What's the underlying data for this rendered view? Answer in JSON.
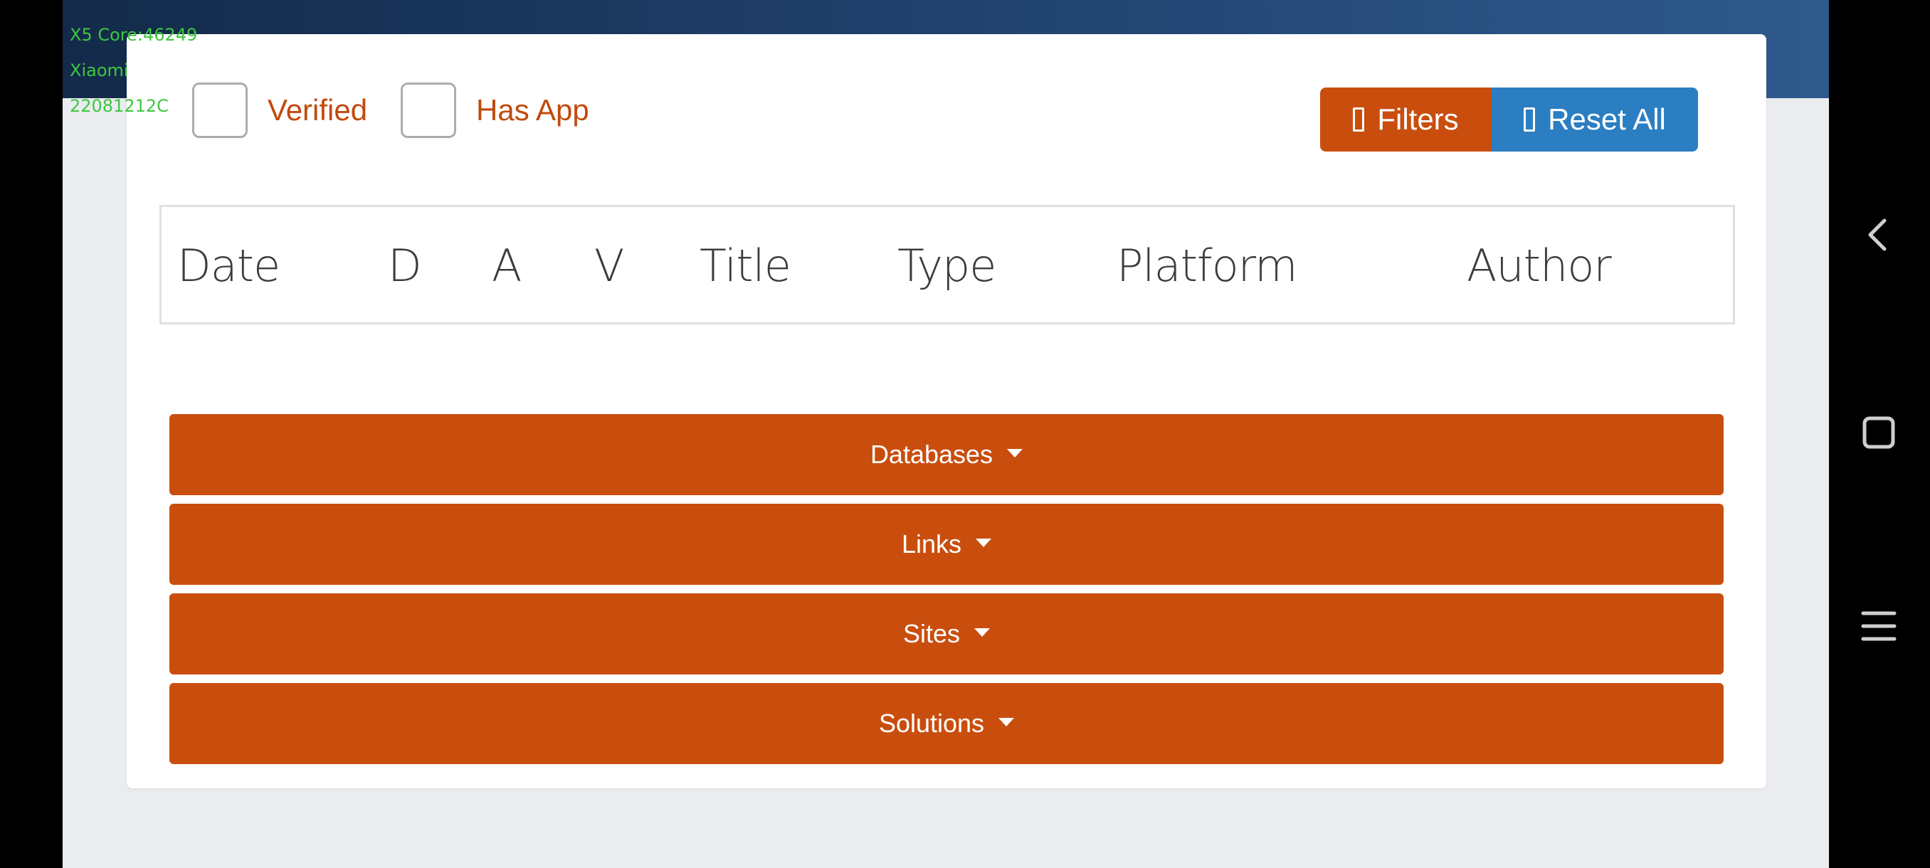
{
  "debug_overlay": {
    "lines": [
      "X5 Core:46249",
      "Xiaomi",
      "22081212C"
    ]
  },
  "filters": {
    "verified_label": "Verified",
    "has_app_label": "Has App"
  },
  "toolbar": {
    "filters_label": "Filters",
    "reset_label": "Reset All",
    "filters_icon": "box-glyph-icon",
    "reset_icon": "box-glyph-icon"
  },
  "table": {
    "columns": [
      "Date",
      "D",
      "A",
      "V",
      "Title",
      "Type",
      "Platform",
      "Author"
    ]
  },
  "accordions": [
    {
      "label": "Databases"
    },
    {
      "label": "Links"
    },
    {
      "label": "Sites"
    },
    {
      "label": "Solutions"
    }
  ],
  "system_nav": {
    "back_icon": "back-chevron-icon",
    "home_icon": "home-square-icon",
    "menu_icon": "menu-lines-icon"
  },
  "colors": {
    "accent_orange": "#c94e0e",
    "accent_blue": "#2b7ec2",
    "header_dark": "#1f3f6a",
    "debug_green": "#3fc63f"
  }
}
